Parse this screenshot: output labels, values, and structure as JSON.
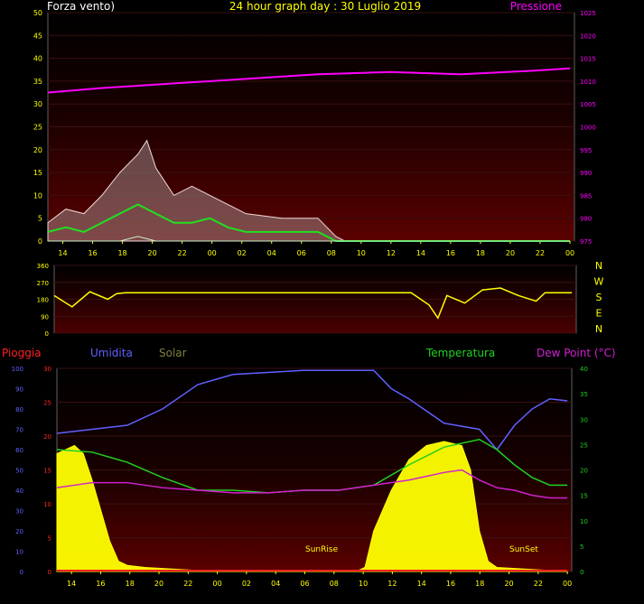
{
  "colors": {
    "background": "#000000",
    "wind_gust": "#f0d8d8",
    "wind_avg": "#c8c8c8",
    "wind_lull": "#20e020",
    "pressure": "#ff00ff",
    "direction": "#ffff00",
    "rain": "#ff2020",
    "humidity": "#6060ff",
    "solar": "#ffff00",
    "temperature": "#20d020",
    "dewpoint": "#d020d0",
    "tick": "#ffff00",
    "label_yellow": "#ffff00",
    "label_white": "#ffffff"
  },
  "chart_data": [
    {
      "type": "line",
      "panel": "top",
      "title": "24 hour graph day : 30 Luglio 2019",
      "left_label": "Forza vento)",
      "right_label": "Pressione",
      "x_ticks": [
        "14",
        "16",
        "18",
        "20",
        "22",
        "00",
        "02",
        "04",
        "06",
        "08",
        "10",
        "12",
        "14",
        "16",
        "18",
        "20",
        "22",
        "00"
      ],
      "left_ylim": [
        0,
        50
      ],
      "left_ticks": [
        "0",
        "5",
        "10",
        "15",
        "20",
        "25",
        "30",
        "35",
        "40",
        "45",
        "50"
      ],
      "right_ylim": [
        975,
        1025
      ],
      "right_ticks": [
        "975",
        "980",
        "985",
        "990",
        "995",
        "1000",
        "1005",
        "1010",
        "1015",
        "1020",
        "1025"
      ],
      "series": [
        {
          "name": "Pressione",
          "axis": "right",
          "x": [
            13,
            16,
            20,
            24,
            28,
            32,
            36,
            40,
            42
          ],
          "y": [
            1007.5,
            1008.5,
            1009.5,
            1010.5,
            1011.5,
            1012,
            1011.5,
            1012.3,
            1012.8
          ]
        },
        {
          "axis": "left",
          "x": [
            13,
            14,
            15,
            16,
            17,
            18,
            18.5,
            19,
            20,
            21,
            22,
            23,
            24,
            26,
            28,
            29,
            29.5,
            30,
            32,
            34,
            36,
            38,
            38.5,
            39,
            40,
            41,
            42
          ],
          "y": [
            4,
            7,
            6,
            10,
            15,
            19,
            22,
            16,
            10,
            12,
            10,
            8,
            6,
            5,
            5,
            1,
            0,
            0,
            0,
            0,
            0,
            0,
            0,
            0,
            0,
            0,
            0
          ]
        },
        {
          "axis": "left",
          "x": [
            13,
            14,
            15,
            16,
            17,
            18,
            19,
            20,
            21,
            22,
            23,
            24,
            26,
            28,
            29,
            30,
            34,
            38,
            42
          ],
          "y": [
            2,
            3,
            2,
            4,
            6,
            8,
            6,
            4,
            4,
            5,
            3,
            2,
            2,
            2,
            0,
            0,
            0,
            0,
            0
          ]
        },
        {
          "axis": "left",
          "x": [
            13,
            14,
            15,
            16,
            17,
            18,
            19,
            20,
            21,
            22,
            23,
            24,
            26,
            28,
            29,
            30,
            34,
            38,
            42
          ],
          "y": [
            0,
            0,
            0,
            0,
            0,
            1,
            0,
            0,
            0,
            0,
            0,
            0,
            0,
            0,
            0,
            0,
            0,
            0,
            0
          ]
        }
      ]
    },
    {
      "type": "line",
      "panel": "middle",
      "x_ticks": [],
      "ylim": [
        0,
        360
      ],
      "left_ticks": [
        "0",
        "90",
        "180",
        "270",
        "360"
      ],
      "compass": [
        "N",
        "W",
        "S",
        "E",
        "N"
      ],
      "series": [
        {
          "axis": "left",
          "x": [
            13,
            14,
            15,
            16,
            16.5,
            17,
            20,
            24,
            28,
            33,
            34,
            34.5,
            35,
            36,
            37,
            38,
            39,
            40,
            40.5,
            41,
            42
          ],
          "y": [
            200,
            140,
            220,
            180,
            210,
            215,
            215,
            215,
            215,
            215,
            150,
            80,
            200,
            160,
            230,
            240,
            200,
            170,
            215,
            215,
            215
          ]
        }
      ]
    },
    {
      "type": "line",
      "panel": "bottom",
      "labels": {
        "rain": "Pioggia",
        "humidity": "Umidita",
        "solar": "Solar",
        "temperature": "Temperatura",
        "dewpoint": "Dew Point (°C)"
      },
      "annotations": [
        "SunRise",
        "SunSet"
      ],
      "x_ticks": [
        "14",
        "16",
        "18",
        "20",
        "22",
        "00",
        "02",
        "04",
        "06",
        "08",
        "10",
        "12",
        "14",
        "16",
        "18",
        "20",
        "22",
        "00"
      ],
      "humidity_ylim": [
        0,
        100
      ],
      "humidity_ticks": [
        "0",
        "10",
        "20",
        "30",
        "40",
        "50",
        "60",
        "70",
        "80",
        "90",
        "100"
      ],
      "rain_ylim": [
        0,
        30
      ],
      "rain_ticks": [
        "0",
        "5",
        "10",
        "15",
        "20",
        "25",
        "30"
      ],
      "temp_ylim": [
        0,
        40
      ],
      "temp_ticks": [
        "0",
        "5",
        "10",
        "15",
        "20",
        "25",
        "30",
        "35",
        "40"
      ],
      "series": [
        {
          "name": "Umidita",
          "axis": "humidity",
          "x": [
            13,
            15,
            17,
            19,
            21,
            23,
            25,
            27,
            29,
            31,
            32,
            33,
            35,
            37,
            38,
            39,
            40,
            41,
            42
          ],
          "y": [
            68,
            70,
            72,
            80,
            92,
            97,
            98,
            99,
            99,
            99,
            90,
            85,
            73,
            70,
            60,
            72,
            80,
            85,
            84
          ]
        },
        {
          "name": "Temperatura",
          "axis": "temp",
          "x": [
            13,
            15,
            17,
            19,
            21,
            23,
            25,
            27,
            29,
            31,
            33,
            35,
            37,
            38,
            39,
            40,
            41,
            42
          ],
          "y": [
            24,
            23.5,
            21.5,
            18.5,
            16,
            16,
            15.5,
            16,
            16,
            17,
            21,
            24.5,
            26,
            24,
            21,
            18.5,
            17,
            17
          ]
        },
        {
          "name": "Dew Point (°C)",
          "axis": "temp",
          "x": [
            13,
            15,
            17,
            19,
            21,
            23,
            25,
            27,
            29,
            31,
            33,
            35,
            36,
            37,
            38,
            39,
            40,
            41,
            42
          ],
          "y": [
            16.5,
            17.5,
            17.5,
            16.5,
            16,
            15.5,
            15.5,
            16,
            16,
            17,
            18,
            19.5,
            20,
            18,
            16.5,
            16,
            15,
            14.5,
            14.5
          ]
        },
        {
          "name": "Pioggia",
          "axis": "rain",
          "x": [
            13,
            42
          ],
          "y": [
            0,
            0
          ]
        },
        {
          "name": "Solar",
          "axis": "humidity",
          "x": [
            13,
            14,
            14.5,
            15,
            16,
            16.5,
            17,
            18,
            20,
            22,
            24,
            28,
            30,
            30.5,
            31,
            32,
            33,
            34,
            35,
            36,
            36.5,
            37,
            37.5,
            38,
            40,
            42
          ],
          "y": [
            58,
            62,
            58,
            45,
            15,
            5,
            3,
            2,
            1,
            0,
            0,
            0,
            0,
            2,
            20,
            40,
            55,
            62,
            64,
            62,
            50,
            20,
            5,
            2,
            1,
            0
          ]
        }
      ]
    }
  ]
}
